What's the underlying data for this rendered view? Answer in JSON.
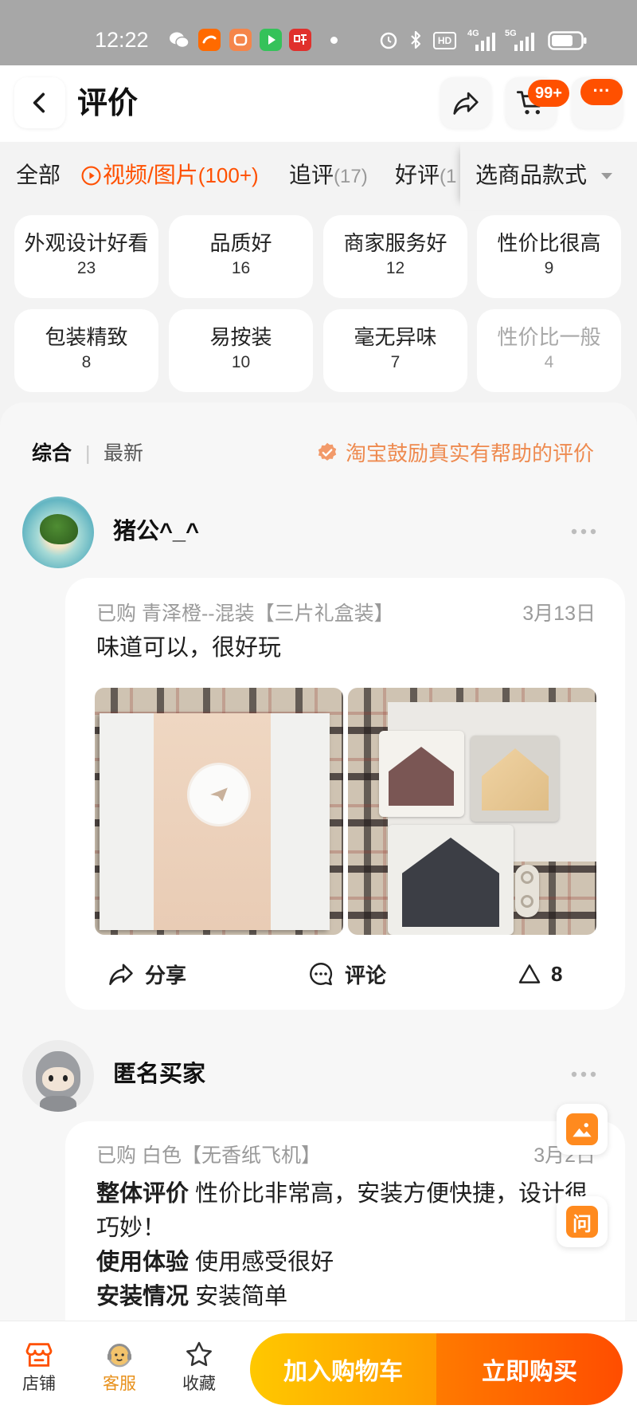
{
  "status_bar": {
    "time": "12:22",
    "hd": "HD",
    "net_4g": "4G",
    "net_5g": "5G"
  },
  "header": {
    "title": "评价",
    "cart_badge": "99+",
    "more_badge": "···"
  },
  "filter_tabs": {
    "all": "全部",
    "media": {
      "label": "视频/图片",
      "count": "(100+)"
    },
    "followup": {
      "label": "追评",
      "count": "(17)"
    },
    "positive": {
      "label": "好评",
      "count": "(1"
    },
    "style_select": "选商品款式"
  },
  "tags": [
    {
      "name": "外观设计好看",
      "count": "23"
    },
    {
      "name": "品质好",
      "count": "16"
    },
    {
      "name": "商家服务好",
      "count": "12"
    },
    {
      "name": "性价比很高",
      "count": "9"
    },
    {
      "name": "包装精致",
      "count": "8"
    },
    {
      "name": "易按装",
      "count": "10"
    },
    {
      "name": "毫无异味",
      "count": "7"
    },
    {
      "name": "性价比一般",
      "count": "4"
    }
  ],
  "sort": {
    "active": "综合",
    "separator": "|",
    "other": "最新",
    "notice": "淘宝鼓励真实有帮助的评价"
  },
  "reviews": [
    {
      "user": "猪公^_^",
      "purchased_label": "已购",
      "sku": "青泽橙--混装【三片礼盒装】",
      "date": "3月13日",
      "text": "味道可以，很好玩",
      "actions": {
        "share": "分享",
        "comment": "评论",
        "likes": "8"
      }
    },
    {
      "user": "匿名买家",
      "purchased_label": "已购",
      "sku": "白色【无香纸飞机】",
      "date": "3月2日",
      "sections": [
        {
          "heading": "整体评价",
          "body": "性价比非常高，安装方便快捷，设计很巧妙！"
        },
        {
          "heading": "使用体验",
          "body": "使用感受很好"
        },
        {
          "heading": "安装情况",
          "body": "安装简单"
        }
      ]
    }
  ],
  "floating": {
    "ask": "问"
  },
  "bottom_bar": {
    "shop": "店铺",
    "service": "客服",
    "favorite": "收藏",
    "add_to_cart": "加入购物车",
    "buy_now": "立即购买"
  },
  "colors": {
    "accent": "#ff5000",
    "notice": "#ee8a4f",
    "cart_button": "#ffc400",
    "buy_button": "#ff5200",
    "service_label": "#e8901a"
  }
}
